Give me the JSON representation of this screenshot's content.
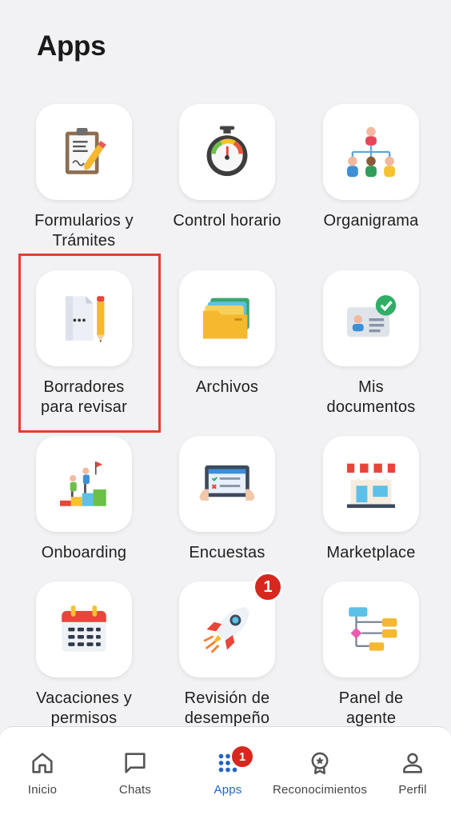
{
  "header": {
    "title": "Apps"
  },
  "apps": [
    {
      "label": "Formularios y\nTrámites",
      "icon": "clipboard-form-icon"
    },
    {
      "label": "Control horario",
      "icon": "stopwatch-icon"
    },
    {
      "label": "Organigrama",
      "icon": "org-chart-icon"
    },
    {
      "label": "Borradores\npara  revisar",
      "icon": "draft-document-pencil-icon"
    },
    {
      "label": "Archivos",
      "icon": "folder-icon"
    },
    {
      "label": "Mis\ndocumentos",
      "icon": "id-card-check-icon"
    },
    {
      "label": "Onboarding",
      "icon": "climbing-steps-icon"
    },
    {
      "label": "Encuestas",
      "icon": "tablet-survey-icon"
    },
    {
      "label": "Marketplace",
      "icon": "storefront-icon"
    },
    {
      "label": "Vacaciones y\npermisos",
      "icon": "calendar-icon"
    },
    {
      "label": "Revisión de\ndesempeño",
      "icon": "rocket-icon",
      "badge": "1"
    },
    {
      "label": "Panel de\nagente",
      "icon": "flowchart-icon"
    }
  ],
  "nav": {
    "items": [
      {
        "label": "Inicio",
        "icon": "home-icon"
      },
      {
        "label": "Chats",
        "icon": "chat-icon"
      },
      {
        "label": "Apps",
        "icon": "apps-grid-icon",
        "badge": "1",
        "active": true
      },
      {
        "label": "Reconocimientos",
        "icon": "award-icon"
      },
      {
        "label": "Perfil",
        "icon": "person-icon"
      }
    ]
  },
  "colors": {
    "accent": "#2464c4",
    "badge": "#d6281f",
    "highlight": "#e0402f",
    "background": "#f2f2f4"
  }
}
